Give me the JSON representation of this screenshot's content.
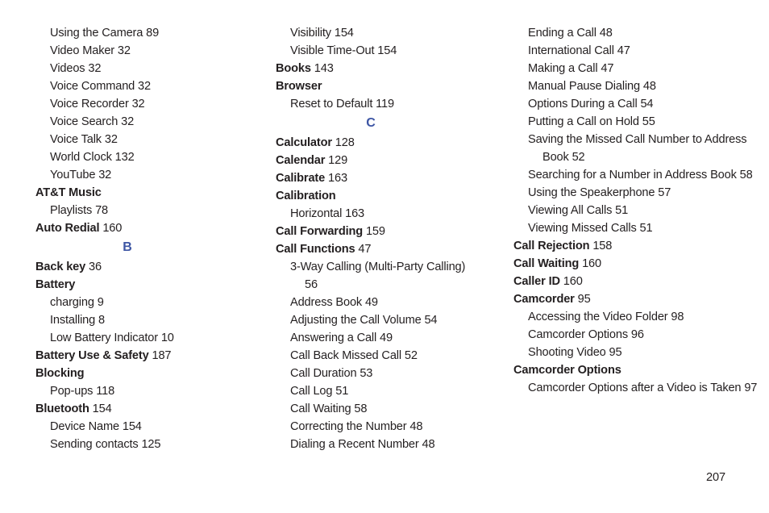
{
  "document": {
    "type": "book-index",
    "page_number": "207",
    "accent_color": "#3d55a4",
    "text_color": "#231f20",
    "background_color": "#ffffff"
  },
  "columns": [
    {
      "id": "column-1",
      "entries": [
        {
          "kind": "sub",
          "label": "Using the Camera",
          "page": "89"
        },
        {
          "kind": "sub",
          "label": "Video Maker",
          "page": "32"
        },
        {
          "kind": "sub",
          "label": "Videos",
          "page": "32"
        },
        {
          "kind": "sub",
          "label": "Voice Command",
          "page": "32"
        },
        {
          "kind": "sub",
          "label": "Voice Recorder",
          "page": "32"
        },
        {
          "kind": "sub",
          "label": "Voice Search",
          "page": "32"
        },
        {
          "kind": "sub",
          "label": "Voice Talk",
          "page": "32"
        },
        {
          "kind": "sub",
          "label": "World Clock",
          "page": "132"
        },
        {
          "kind": "sub",
          "label": "YouTube",
          "page": "32"
        },
        {
          "kind": "main",
          "label": "AT&T Music",
          "page": ""
        },
        {
          "kind": "sub",
          "label": "Playlists",
          "page": "78"
        },
        {
          "kind": "main",
          "label": "Auto Redial",
          "page": "160"
        },
        {
          "kind": "letter",
          "label": "B",
          "page": ""
        },
        {
          "kind": "main",
          "label": "Back key",
          "page": "36"
        },
        {
          "kind": "main",
          "label": "Battery",
          "page": ""
        },
        {
          "kind": "sub",
          "label": "charging",
          "page": "9"
        },
        {
          "kind": "sub",
          "label": "Installing",
          "page": "8"
        },
        {
          "kind": "sub",
          "label": "Low Battery Indicator",
          "page": "10"
        },
        {
          "kind": "main",
          "label": "Battery Use & Safety",
          "page": "187"
        },
        {
          "kind": "main",
          "label": "Blocking",
          "page": ""
        },
        {
          "kind": "sub",
          "label": "Pop-ups",
          "page": "118"
        },
        {
          "kind": "main",
          "label": "Bluetooth",
          "page": "154"
        },
        {
          "kind": "sub",
          "label": "Device Name",
          "page": "154"
        },
        {
          "kind": "sub",
          "label": "Sending contacts",
          "page": "125"
        }
      ]
    },
    {
      "id": "column-2",
      "entries": [
        {
          "kind": "sub",
          "label": "Visibility",
          "page": "154"
        },
        {
          "kind": "sub",
          "label": "Visible Time-Out",
          "page": "154"
        },
        {
          "kind": "main",
          "label": "Books",
          "page": "143"
        },
        {
          "kind": "main",
          "label": "Browser",
          "page": ""
        },
        {
          "kind": "sub",
          "label": "Reset to Default",
          "page": "119"
        },
        {
          "kind": "letter",
          "label": "C",
          "page": ""
        },
        {
          "kind": "main",
          "label": "Calculator",
          "page": "128"
        },
        {
          "kind": "main",
          "label": "Calendar",
          "page": "129"
        },
        {
          "kind": "main",
          "label": "Calibrate",
          "page": "163"
        },
        {
          "kind": "main",
          "label": "Calibration",
          "page": ""
        },
        {
          "kind": "sub",
          "label": "Horizontal",
          "page": "163"
        },
        {
          "kind": "main",
          "label": "Call Forwarding",
          "page": "159"
        },
        {
          "kind": "main",
          "label": "Call Functions",
          "page": "47"
        },
        {
          "kind": "wrap",
          "label": "3-Way Calling (Multi-Party Calling)",
          "page": "56"
        },
        {
          "kind": "sub",
          "label": "Address Book",
          "page": "49"
        },
        {
          "kind": "sub",
          "label": "Adjusting the Call Volume",
          "page": "54"
        },
        {
          "kind": "sub",
          "label": "Answering a Call",
          "page": "49"
        },
        {
          "kind": "sub",
          "label": "Call Back Missed Call",
          "page": "52"
        },
        {
          "kind": "sub",
          "label": "Call Duration",
          "page": "53"
        },
        {
          "kind": "sub",
          "label": "Call Log",
          "page": "51"
        },
        {
          "kind": "sub",
          "label": "Call Waiting",
          "page": "58"
        },
        {
          "kind": "sub",
          "label": "Correcting the Number",
          "page": "48"
        },
        {
          "kind": "sub",
          "label": "Dialing a Recent Number",
          "page": "48"
        }
      ]
    },
    {
      "id": "column-3",
      "entries": [
        {
          "kind": "sub",
          "label": "Ending a Call",
          "page": "48"
        },
        {
          "kind": "sub",
          "label": "International Call",
          "page": "47"
        },
        {
          "kind": "sub",
          "label": "Making a Call",
          "page": "47"
        },
        {
          "kind": "sub",
          "label": "Manual Pause Dialing",
          "page": "48"
        },
        {
          "kind": "sub",
          "label": "Options During a Call",
          "page": "54"
        },
        {
          "kind": "sub",
          "label": "Putting a Call on Hold",
          "page": "55"
        },
        {
          "kind": "wrap",
          "label": "Saving the Missed Call Number to Address Book",
          "page": "52"
        },
        {
          "kind": "wrap",
          "label": "Searching for a Number in Address Book",
          "page": "58"
        },
        {
          "kind": "sub",
          "label": "Using the Speakerphone",
          "page": "57"
        },
        {
          "kind": "sub",
          "label": "Viewing All Calls",
          "page": "51"
        },
        {
          "kind": "sub",
          "label": "Viewing Missed Calls",
          "page": "51"
        },
        {
          "kind": "main",
          "label": "Call Rejection",
          "page": "158"
        },
        {
          "kind": "main",
          "label": "Call Waiting",
          "page": "160"
        },
        {
          "kind": "main",
          "label": "Caller ID",
          "page": "160"
        },
        {
          "kind": "main",
          "label": "Camcorder",
          "page": "95"
        },
        {
          "kind": "sub",
          "label": "Accessing the Video Folder",
          "page": "98"
        },
        {
          "kind": "sub",
          "label": "Camcorder Options",
          "page": "96"
        },
        {
          "kind": "sub",
          "label": "Shooting Video",
          "page": "95"
        },
        {
          "kind": "main",
          "label": "Camcorder Options",
          "page": ""
        },
        {
          "kind": "wrap",
          "label": "Camcorder Options after a Video is Taken",
          "page": "97"
        }
      ]
    }
  ]
}
